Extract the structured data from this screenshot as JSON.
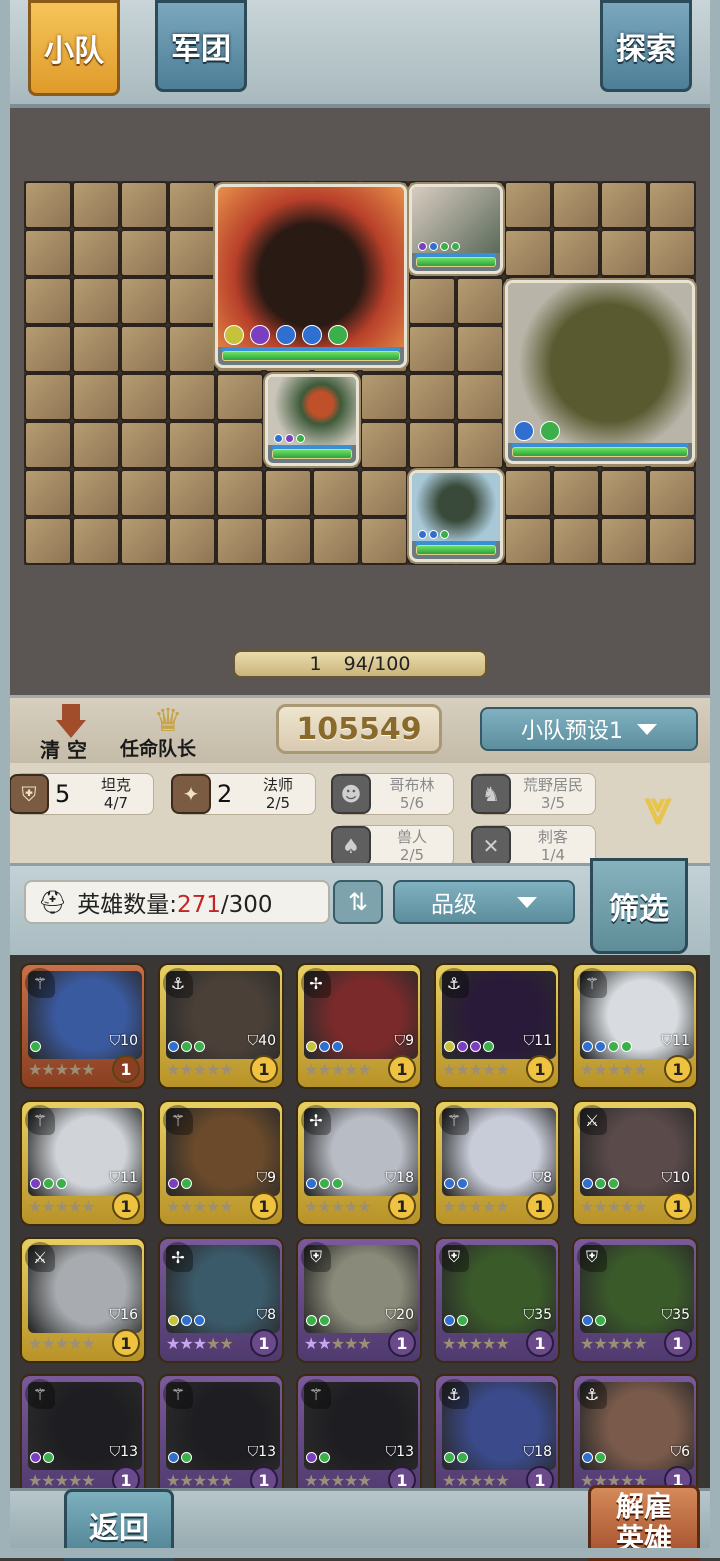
{
  "tabs": {
    "squad": "小队",
    "legion": "军团",
    "explore": "探索"
  },
  "colors": {
    "tab_active": "#f0b545",
    "tab_blue": "#5e8fa8",
    "gold_rarity": "#e1c458",
    "purple_rarity": "#6a4a8a",
    "red_rarity": "#b05a35"
  },
  "battlefield": {
    "units": [
      {
        "name": "flame-bear",
        "art": "#b8402a",
        "dots": [
          "#c7c23c",
          "#7a3fc0",
          "#2f6fd0",
          "#2f6fd0",
          "#3bb04a"
        ]
      },
      {
        "name": "lizard-warrior-top",
        "art": "#9c8f8a",
        "dots": [
          "#7a3fc0",
          "#2f6fd0",
          "#3bb04a",
          "#3bb04a"
        ]
      },
      {
        "name": "iron-golem",
        "art": "#6c6a3c",
        "dots": [
          "#2f6fd0",
          "#3bb04a"
        ]
      },
      {
        "name": "scythe-goblin",
        "art": "#4f6a40",
        "dots": [
          "#2f6fd0",
          "#7a3fc0",
          "#3bb04a"
        ]
      },
      {
        "name": "lizard-shaman",
        "art": "#4f6f7a",
        "dots": [
          "#2f6fd0",
          "#2f6fd0",
          "#3bb04a"
        ]
      }
    ],
    "progress_left": "1",
    "progress_right": "94/100"
  },
  "controls": {
    "clear": "清  空",
    "captain": "任命队长",
    "power": "105549",
    "preset": "小队预设1"
  },
  "synergies": [
    {
      "icon": "shield-icon",
      "glyph": "⛨",
      "num": "5",
      "name": "坦克",
      "progress": "4/7",
      "active": true
    },
    {
      "icon": "mage-icon",
      "glyph": "✦",
      "num": "2",
      "name": "法师",
      "progress": "2/5",
      "active": true
    },
    {
      "icon": "goblin-icon",
      "glyph": "☻",
      "num": "",
      "name": "哥布林",
      "progress": "5/6",
      "active": false
    },
    {
      "icon": "wild-icon",
      "glyph": "♞",
      "num": "",
      "name": "荒野居民",
      "progress": "3/5",
      "active": false
    },
    {
      "icon": "orc-icon",
      "glyph": "♠",
      "num": "",
      "name": "兽人",
      "progress": "2/5",
      "active": false
    },
    {
      "icon": "assassin-icon",
      "glyph": "✕",
      "num": "",
      "name": "刺客",
      "progress": "1/4",
      "active": false
    }
  ],
  "hero_count": {
    "label": "英雄数量:",
    "current": "271",
    "max": "/300",
    "grade": "品级",
    "filter": "筛选"
  },
  "heroes": [
    {
      "rarity": "red",
      "cls": "⚚",
      "art": "#3a5aa0",
      "cost": "10",
      "stars": 0,
      "dots": [
        "#3bb04a"
      ],
      "lvl": "1"
    },
    {
      "rarity": "gold",
      "cls": "⚓",
      "art": "#4a4038",
      "cost": "40",
      "stars": 0,
      "dots": [
        "#2f6fd0",
        "#3bb04a",
        "#3bb04a"
      ],
      "lvl": "1"
    },
    {
      "rarity": "gold",
      "cls": "✢",
      "art": "#7a2a2a",
      "cost": "9",
      "stars": 0,
      "dots": [
        "#c7c23c",
        "#2f6fd0",
        "#2f6fd0"
      ],
      "lvl": "1"
    },
    {
      "rarity": "gold",
      "cls": "⚓",
      "art": "#2a1a3a",
      "cost": "11",
      "stars": 0,
      "dots": [
        "#c7c23c",
        "#7a3fc0",
        "#7a3fc0",
        "#3bb04a"
      ],
      "lvl": "1"
    },
    {
      "rarity": "gold",
      "cls": "⚚",
      "art": "#d8dce0",
      "cost": "11",
      "stars": 0,
      "dots": [
        "#2f6fd0",
        "#2f6fd0",
        "#3bb04a",
        "#3bb04a"
      ],
      "lvl": "1"
    },
    {
      "rarity": "gold",
      "cls": "⚚",
      "art": "#d0d4d8",
      "cost": "11",
      "stars": 0,
      "dots": [
        "#7a3fc0",
        "#3bb04a",
        "#3bb04a"
      ],
      "lvl": "1"
    },
    {
      "rarity": "gold",
      "cls": "⚚",
      "art": "#6a4a2a",
      "cost": "9",
      "stars": 0,
      "dots": [
        "#7a3fc0",
        "#3bb04a"
      ],
      "lvl": "1"
    },
    {
      "rarity": "gold",
      "cls": "✢",
      "art": "#b8bcc4",
      "cost": "18",
      "stars": 0,
      "dots": [
        "#2f6fd0",
        "#3bb04a",
        "#3bb04a"
      ],
      "lvl": "1"
    },
    {
      "rarity": "gold",
      "cls": "⚚",
      "art": "#c8ccd8",
      "cost": "8",
      "stars": 0,
      "dots": [
        "#2f6fd0",
        "#2f6fd0"
      ],
      "lvl": "1"
    },
    {
      "rarity": "gold",
      "cls": "⚔",
      "art": "#5a4a4a",
      "cost": "10",
      "stars": 0,
      "dots": [
        "#2f6fd0",
        "#3bb04a",
        "#3bb04a"
      ],
      "lvl": "1"
    },
    {
      "rarity": "gold",
      "cls": "⚔",
      "art": "#a8acb0",
      "cost": "16",
      "stars": 0,
      "dots": [],
      "lvl": "1"
    },
    {
      "rarity": "purple",
      "cls": "✢",
      "art": "#3a5a6a",
      "cost": "8",
      "stars": 3,
      "dots": [
        "#c7c23c",
        "#2f6fd0",
        "#2f6fd0"
      ],
      "lvl": "1"
    },
    {
      "rarity": "purple",
      "cls": "⛨",
      "art": "#8a8a7a",
      "cost": "20",
      "stars": 2,
      "dots": [
        "#3bb04a",
        "#3bb04a"
      ],
      "lvl": "1"
    },
    {
      "rarity": "purple",
      "cls": "⛨",
      "art": "#3a5a2a",
      "cost": "35",
      "stars": 0,
      "dots": [
        "#2f6fd0",
        "#3bb04a"
      ],
      "lvl": "1"
    },
    {
      "rarity": "purple",
      "cls": "⛨",
      "art": "#3a5a2a",
      "cost": "35",
      "stars": 0,
      "dots": [
        "#2f6fd0",
        "#3bb04a"
      ],
      "lvl": "1"
    },
    {
      "rarity": "purple",
      "cls": "⚚",
      "art": "#1e1e22",
      "cost": "13",
      "stars": 0,
      "dots": [
        "#7a3fc0",
        "#3bb04a"
      ],
      "lvl": "1"
    },
    {
      "rarity": "purple",
      "cls": "⚚",
      "art": "#1e1e22",
      "cost": "13",
      "stars": 0,
      "dots": [
        "#2f6fd0",
        "#3bb04a"
      ],
      "lvl": "1"
    },
    {
      "rarity": "purple",
      "cls": "⚚",
      "art": "#1e1e22",
      "cost": "13",
      "stars": 0,
      "dots": [
        "#7a3fc0",
        "#3bb04a"
      ],
      "lvl": "1"
    },
    {
      "rarity": "purple",
      "cls": "⚓",
      "art": "#3a4a8a",
      "cost": "18",
      "stars": 0,
      "dots": [
        "#3bb04a",
        "#3bb04a"
      ],
      "lvl": "1"
    },
    {
      "rarity": "purple",
      "cls": "⚓",
      "art": "#7a5a4a",
      "cost": "6",
      "stars": 0,
      "dots": [
        "#2f6fd0",
        "#3bb04a"
      ],
      "lvl": "1"
    }
  ],
  "bottom": {
    "back": "返回",
    "dismiss_line1": "解雇",
    "dismiss_line2": "英雄"
  }
}
